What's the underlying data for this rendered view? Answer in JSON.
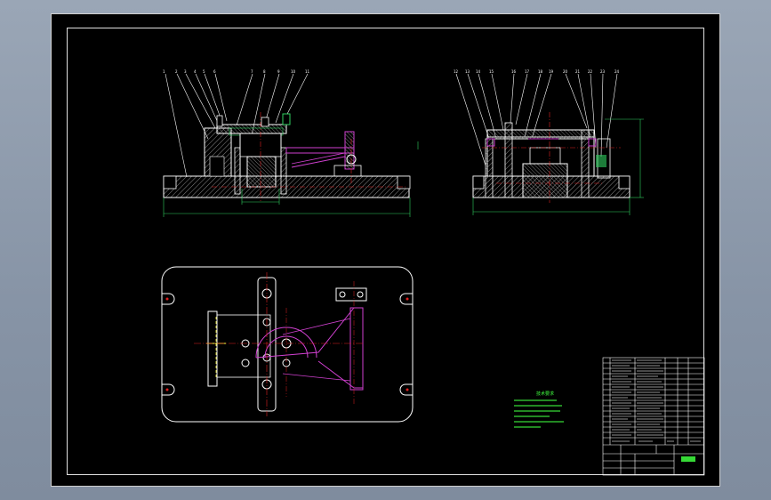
{
  "drawing": {
    "sheet_background": "#000000",
    "frame_color": "#e0e0e0",
    "colors": {
      "outline": "#ffffff",
      "hatch": "#9a9a9a",
      "centerline": "#e02020",
      "dimension": "#30d060",
      "part_magenta": "#d040d0",
      "notes_green": "#40ff40",
      "yellow": "#ffff40"
    }
  },
  "notes": {
    "title_lines": [
      "技术要求"
    ],
    "color": "#40ff40"
  },
  "title_block": {
    "stamp_color": "#40ff40"
  }
}
